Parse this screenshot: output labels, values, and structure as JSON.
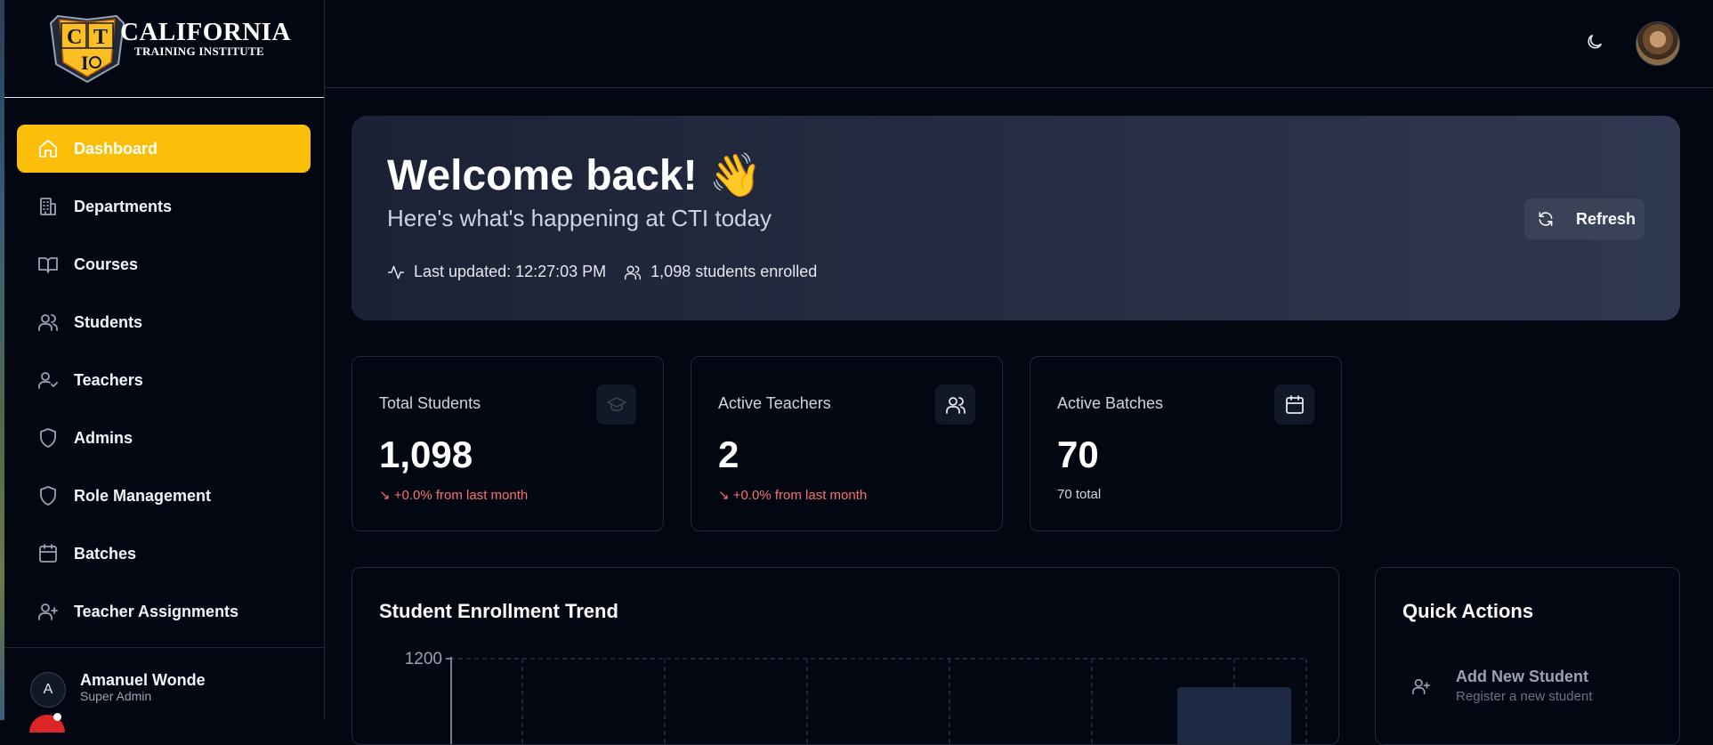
{
  "brand": {
    "name": "CALIFORNIA",
    "subtitle": "TRAINING INSTITUTE"
  },
  "sidebar": {
    "items": [
      {
        "label": "Dashboard",
        "icon": "home-icon",
        "active": true
      },
      {
        "label": "Departments",
        "icon": "building-icon"
      },
      {
        "label": "Courses",
        "icon": "book-icon"
      },
      {
        "label": "Students",
        "icon": "users-icon"
      },
      {
        "label": "Teachers",
        "icon": "user-check-icon"
      },
      {
        "label": "Admins",
        "icon": "shield-icon"
      },
      {
        "label": "Role Management",
        "icon": "shield-icon"
      },
      {
        "label": "Batches",
        "icon": "calendar-icon"
      },
      {
        "label": "Teacher Assignments",
        "icon": "user-plus-icon"
      }
    ]
  },
  "user": {
    "initial": "A",
    "name": "Amanuel Wonde",
    "role": "Super Admin"
  },
  "topbar": {
    "theme_icon": "moon-icon",
    "avatar_icon": "profile-photo"
  },
  "hero": {
    "title": "Welcome back! 👋",
    "subtitle": "Here's what's happening at CTI today",
    "last_updated": "Last updated: 12:27:03 PM",
    "enrolled": "1,098 students enrolled",
    "refresh_label": "Refresh"
  },
  "stats": [
    {
      "label": "Total Students",
      "value": "1,098",
      "note": "↘ +0.0% from last month",
      "icon": "graduation-cap-icon"
    },
    {
      "label": "Active Teachers",
      "value": "2",
      "note": "↘ +0.0% from last month",
      "icon": "users-icon"
    },
    {
      "label": "Active Batches",
      "value": "70",
      "note": "70 total",
      "icon": "calendar-icon"
    }
  ],
  "chart": {
    "title": "Student Enrollment Trend",
    "y_tick": "1200"
  },
  "chart_data": {
    "type": "bar",
    "title": "Student Enrollment Trend",
    "ylim": [
      0,
      1200
    ],
    "yticks": [
      "1200"
    ],
    "grid": true,
    "categories": [],
    "values": []
  },
  "quick_actions": {
    "title": "Quick Actions",
    "items": [
      {
        "label": "Add New Student",
        "desc": "Register a new student",
        "icon": "user-plus-icon"
      }
    ]
  },
  "colors": {
    "accent": "#fbbf0a",
    "background": "#030712",
    "hero_bg": "#272f45",
    "down": "#f87171"
  }
}
